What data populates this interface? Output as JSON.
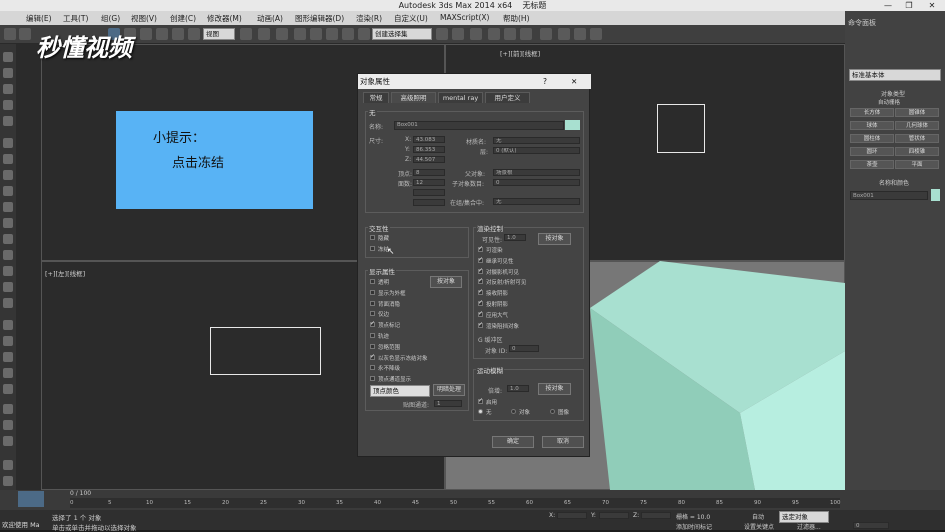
{
  "window": {
    "title": "Autodesk 3ds Max  2014 x64",
    "file": "无标题",
    "min": "—",
    "restore": "❐",
    "close": "✕"
  },
  "menu": [
    "编辑(E)",
    "工具(T)",
    "组(G)",
    "视图(V)",
    "创建(C)",
    "修改器(M)",
    "动画(A)",
    "图形编辑器(D)",
    "渲染(R)",
    "自定义(U)",
    "MAXScript(X)",
    "帮助(H)"
  ],
  "toolbar": {
    "view_combo": "视图",
    "selset_combo": "创建选择集"
  },
  "logo": "秒懂视频",
  "tip": {
    "line1": "小提示：",
    "line2": "点击冻结"
  },
  "viewports": {
    "top_right": "[+][前][线框]",
    "bottom_left": "[+][左][线框]"
  },
  "dialog": {
    "title": "对象属性",
    "help": "?",
    "close": "✕",
    "tabs": [
      "常规",
      "高级照明",
      "mental ray",
      "用户定义"
    ],
    "info": {
      "group": "无",
      "name_label": "名称:",
      "name_value": "Box001",
      "dims_label": "尺寸:",
      "x_label": "X:",
      "x": "43.083",
      "y_label": "Y:",
      "y": "86.353",
      "z_label": "Z:",
      "z": "44.507",
      "verts_label": "顶点:",
      "verts": "8",
      "faces_label": "面数:",
      "faces": "12",
      "material_label": "材质名:",
      "material": "无",
      "layer_label": "层:",
      "layer": "0 (默认)",
      "parent_label": "父对象:",
      "parent": "场景根",
      "children_label": "子对象数目:",
      "children": "0",
      "group_label": "在组/集合中:"
    },
    "interactivity": {
      "group": "交互性",
      "hide": "隐藏",
      "freeze": "冻结"
    },
    "display": {
      "group": "显示属性",
      "by_object": "按对象",
      "items": [
        "透明",
        "显示为外框",
        "背面消隐",
        "仅边",
        "顶点标记",
        "轨迹",
        "忽略范围",
        "以灰色显示冻结对象",
        "永不降级",
        "顶点通道显示"
      ],
      "vertex_color": "顶点颜色",
      "shaded": "明暗处理",
      "mapchannel_label": "贴图通道:",
      "mapchannel": "1"
    },
    "render": {
      "group": "渲染控制",
      "visibility_label": "可见性:",
      "visibility": "1.0",
      "by_object": "按对象",
      "items": [
        "可渲染",
        "继承可见性",
        "对摄影机可见",
        "对反射/折射可见",
        "接收阴影",
        "投射阴影",
        "应用大气",
        "渲染阻挡对象"
      ],
      "gbuffer": "G 缓冲区",
      "objid_label": "对象 ID:",
      "objid": "0"
    },
    "motionblur": {
      "group": "运动模糊",
      "mult_label": "倍增:",
      "mult": "1.0",
      "by_object": "按对象",
      "enabled": "启用",
      "none": "无",
      "object": "对象",
      "image": "图像"
    },
    "ok": "确定",
    "cancel": "取消"
  },
  "command": {
    "title": "命令面板",
    "combo": "标准基本体",
    "rollout": "对象类型",
    "autogrid": "自动栅格",
    "buttons": [
      "长方体",
      "圆锥体",
      "球体",
      "几何球体",
      "圆柱体",
      "管状体",
      "圆环",
      "四棱锥",
      "茶壶",
      "平面"
    ],
    "name_rollout": "名称和颜色",
    "name_value": "Box001"
  },
  "timeline": {
    "frame": "0 / 100",
    "ticks": [
      "0",
      "5",
      "10",
      "15",
      "20",
      "25",
      "30",
      "35",
      "40",
      "45",
      "50",
      "55",
      "60",
      "65",
      "70",
      "75",
      "80",
      "85",
      "90",
      "95",
      "100"
    ]
  },
  "status": {
    "welcome": "欢迎使用 Ma",
    "selected": "选择了 1 个 对象",
    "hint": "单击或单击并拖动以选择对象",
    "x_label": "X:",
    "y_label": "Y:",
    "z_label": "Z:",
    "grid": "栅格 = 10.0",
    "autokey": "自动",
    "selected_combo": "选定对象",
    "add_time": "添加时间标记",
    "set_key": "设置关键点",
    "filter": "过滤器...",
    "frame": "0"
  }
}
